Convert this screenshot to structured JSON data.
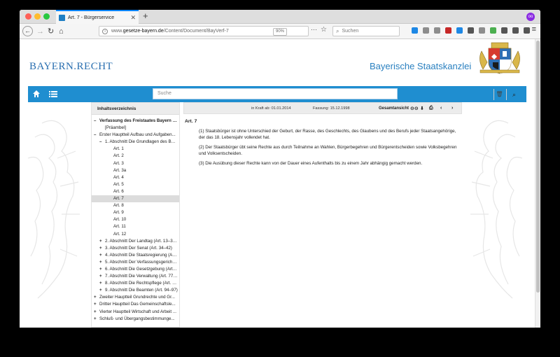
{
  "browser": {
    "tab_title": "Art. 7 - Bürgerservice",
    "tab_close": "✕",
    "new_tab": "+",
    "back": "←",
    "forward": "→",
    "reload": "↻",
    "home": "⌂",
    "url_prefix": "www.",
    "url_host": "gesetze-bayern.de",
    "url_path": "/Content/Document/BayVerf-7",
    "zoom": "90%",
    "page_actions": "···",
    "bookmark": "☆",
    "search_placeholder": "Suchen",
    "menu": "≡",
    "toolbar_colors": [
      "#1e88e5",
      "#8d8d8d",
      "#8d8d8d",
      "#c62828",
      "#1e88e5",
      "#555555",
      "#8d8d8d",
      "#4caf50",
      "#555555",
      "#555555",
      "#555555"
    ],
    "ext_label": "oo"
  },
  "header": {
    "brand": "BAYERN.RECHT",
    "agency": "Bayerische Staatskanzlei",
    "search_placeholder": "Suche",
    "trash_icon": "🗑",
    "search_icon": "⌕",
    "accent": "#1f8ed0"
  },
  "toc": {
    "title": "Inhaltsverzeichnis",
    "items": [
      {
        "mark": "–",
        "label": "Verfassung des Freistaates Bayern in der Fassung...",
        "level": "lvl0-bold"
      },
      {
        "mark": "",
        "label": "[Präambel]",
        "level": "lvl1"
      },
      {
        "mark": "–",
        "label": "Erster Hauptteil Aufbau und Aufgaben...",
        "level": "lvl0"
      },
      {
        "mark": "–",
        "label": "1. Abschnitt Die Grundlagen des Bay...",
        "level": "lvl2"
      },
      {
        "mark": "",
        "label": "Art. 1",
        "level": "lvl3"
      },
      {
        "mark": "",
        "label": "Art. 2",
        "level": "lvl3"
      },
      {
        "mark": "",
        "label": "Art. 3",
        "level": "lvl3"
      },
      {
        "mark": "",
        "label": "Art. 3a",
        "level": "lvl3"
      },
      {
        "mark": "",
        "label": "Art. 4",
        "level": "lvl3"
      },
      {
        "mark": "",
        "label": "Art. 5",
        "level": "lvl3"
      },
      {
        "mark": "",
        "label": "Art. 6",
        "level": "lvl3"
      },
      {
        "mark": "",
        "label": "Art. 7",
        "level": "lvl3",
        "active": true
      },
      {
        "mark": "",
        "label": "Art. 8",
        "level": "lvl3"
      },
      {
        "mark": "",
        "label": "Art. 9",
        "level": "lvl3"
      },
      {
        "mark": "",
        "label": "Art. 10",
        "level": "lvl3"
      },
      {
        "mark": "",
        "label": "Art. 11",
        "level": "lvl3"
      },
      {
        "mark": "",
        "label": "Art. 12",
        "level": "lvl3"
      },
      {
        "mark": "+",
        "label": "2. Abschnitt Der Landtag (Art. 13–33a)",
        "level": "lvl2"
      },
      {
        "mark": "+",
        "label": "3. Abschnitt Der Senat (Art. 34–42)",
        "level": "lvl2"
      },
      {
        "mark": "+",
        "label": "4. Abschnitt Die Staatsregierung (Art. ...",
        "level": "lvl2"
      },
      {
        "mark": "+",
        "label": "5. Abschnitt Der Verfassungsgerichts...",
        "level": "lvl2"
      },
      {
        "mark": "+",
        "label": "6. Abschnitt Die Gesetzgebung (Art. ...",
        "level": "lvl2"
      },
      {
        "mark": "+",
        "label": "7. Abschnitt Die Verwaltung (Art. 77–...",
        "level": "lvl2"
      },
      {
        "mark": "+",
        "label": "8. Abschnitt Die Rechtspflege (Art. 8...",
        "level": "lvl2"
      },
      {
        "mark": "+",
        "label": "9. Abschnitt Die Beamten (Art. 94–97)",
        "level": "lvl2"
      },
      {
        "mark": "+",
        "label": "Zweiter Hauptteil Grundrechte und Gr...",
        "level": "lvl0"
      },
      {
        "mark": "+",
        "label": "Dritter Hauptteil Das Gemeinschaftsle...",
        "level": "lvl0"
      },
      {
        "mark": "+",
        "label": "Vierter Hauptteil Wirtschaft und Arbeit ...",
        "level": "lvl0"
      },
      {
        "mark": "+",
        "label": "Schluß- und Übergangsbestimmunge...",
        "level": "lvl0"
      }
    ]
  },
  "article": {
    "in_kraft": "in Kraft ab: 01.01.2014",
    "fassung": "Fassung: 15.12.1998",
    "gesamtansicht": "Gesamtansicht",
    "icons": {
      "link": "⊖⊖",
      "download": "⬇",
      "print": "⎙",
      "prev": "‹",
      "next": "›"
    },
    "title": "Art. 7",
    "paragraphs": [
      "(1) Staatsbürger ist ohne Unterschied der Geburt, der Rasse, des Geschlechts, des Glaubens und des Berufs jeder Staatsangehörige, der das 18. Lebensjahr vollendet hat.",
      "(2) Der Staatsbürger übt seine Rechte aus durch Teilnahme an Wahlen, Bürgerbegehren und Bürgerentscheiden sowie Volksbegehren und Volksentscheiden.",
      "(3) Die Ausübung dieser Rechte kann von der Dauer eines Aufenthalts bis zu einem Jahr abhängig gemacht werden."
    ]
  }
}
